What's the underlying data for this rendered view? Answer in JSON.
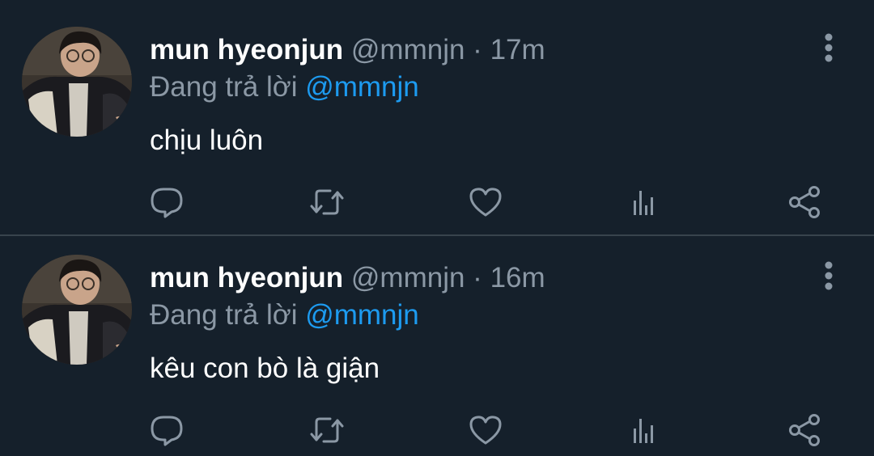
{
  "tweets": [
    {
      "name": "mun hyeonjun",
      "handle": "@mmnjn",
      "separator": "·",
      "time": "17m",
      "reply_prefix": "Đang trả lời",
      "reply_to": "@mmnjn",
      "text": "chịu luôn"
    },
    {
      "name": "mun hyeonjun",
      "handle": "@mmnjn",
      "separator": "·",
      "time": "16m",
      "reply_prefix": "Đang trả lời",
      "reply_to": "@mmnjn",
      "text": "kêu con bò là giận"
    }
  ],
  "icons": {
    "more": "more-vertical-icon",
    "reply": "reply-icon",
    "retweet": "retweet-icon",
    "like": "heart-icon",
    "views": "analytics-icon",
    "share": "share-icon"
  },
  "colors": {
    "background": "#15202b",
    "text": "#ffffff",
    "secondary_text": "#8b98a5",
    "link": "#1d9bf0",
    "divider": "#38444d"
  }
}
